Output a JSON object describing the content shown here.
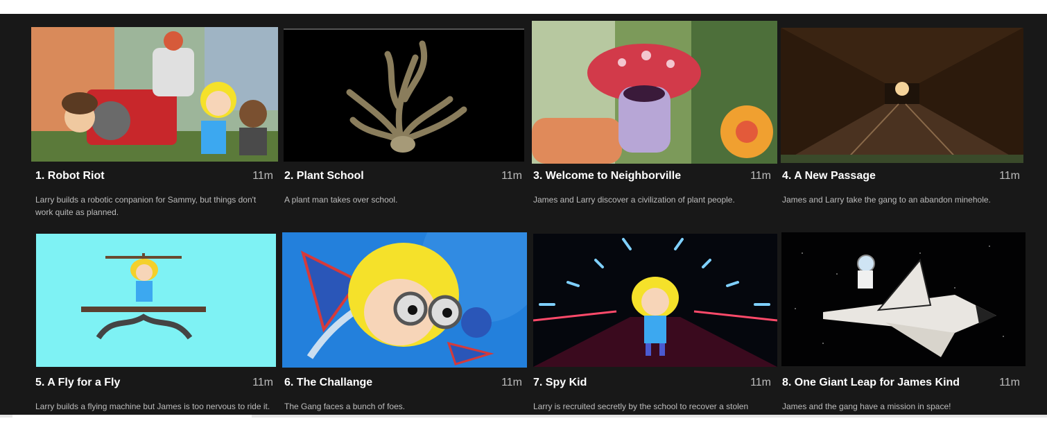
{
  "episodes": [
    {
      "title": "1. Robot Riot",
      "duration": "11m",
      "description": "Larry builds a robotic conpanion for Sammy, but things don't work quite as planned."
    },
    {
      "title": "2. Plant School",
      "duration": "11m",
      "description": "A plant man takes over school."
    },
    {
      "title": "3. Welcome to Neighborville",
      "duration": "11m",
      "description": "James and Larry discover a civilization of plant people."
    },
    {
      "title": "4. A New Passage",
      "duration": "11m",
      "description": "James and Larry take the gang to an abandon minehole."
    },
    {
      "title": "5. A Fly for a Fly",
      "duration": "11m",
      "description": "Larry builds a flying machine but James is too nervous to ride it."
    },
    {
      "title": "6. The Challange",
      "duration": "11m",
      "description": "The Gang faces a bunch of foes."
    },
    {
      "title": "7. Spy Kid",
      "duration": "11m",
      "description": "Larry is recruited secretly by the school to recover a stolen"
    },
    {
      "title": "8. One Giant Leap for James Kind",
      "duration": "11m",
      "description": "James and the gang have a mission in space!"
    }
  ]
}
